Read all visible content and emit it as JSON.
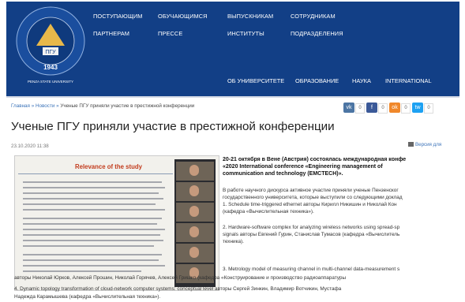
{
  "header": {
    "logo": {
      "year": "1943",
      "ring_text": "ПЕНЗЕНСКИЙ ГОСУДАРСТВЕННЫЙ УНИВЕРСИТЕТ",
      "bottom_text": "PENZA STATE UNIVERSITY",
      "book_letters": "ПГУ"
    },
    "nav_top_row1": [
      "ПОСТУПАЮЩИМ",
      "ОБУЧАЮЩИМСЯ",
      "ВЫПУСКНИКАМ",
      "СОТРУДНИКАМ"
    ],
    "nav_top_row2": [
      "ПАРТНЕРАМ",
      "ПРЕССЕ",
      "ИНСТИТУТЫ",
      "ПОДРАЗДЕЛЕНИЯ"
    ],
    "nav_bottom": [
      "ОБ УНИВЕРСИТЕТЕ",
      "ОБРАЗОВАНИЕ",
      "НАУКА",
      "INTERNATIONAL"
    ]
  },
  "breadcrumb": {
    "home": "Главная",
    "sep": "»",
    "news": "Новости",
    "current": "Ученые ПГУ приняли участие в престижной конференции"
  },
  "share": {
    "buttons": [
      "vk",
      "f",
      "ok",
      "tw"
    ],
    "counts": [
      "0",
      "0",
      "0",
      "0"
    ],
    "colors": [
      "#4c75a3",
      "#3b5998",
      "#f0882b",
      "#1da1f2"
    ]
  },
  "article": {
    "title": "Ученые ПГУ приняли участие в престижной конференции",
    "date": "23.10.2020 11:38",
    "print_label": "Версия для",
    "slide_title": "Relevance of the study",
    "lead_lines": [
      "20-21 октября в Вене (Австрия) состоялась международная конфе",
      "«2020 International conference «Engineering management of",
      "communication and technology (EMCTECH)»."
    ],
    "para1": [
      "В работе научного дискурса активное участие приняли ученые Пензенског",
      "государственного университета, которые выступили со следующими доклад",
      "1. Schedule time-triggered ethernet авторы Кирилл Никишин и Николай Кон",
      "(кафедра «Вычислительная техника»)."
    ],
    "para2": [
      "2. Hardware-software complex for analyzing wireless networks using spread-sp",
      "signals авторы Евгений Гурин, Станислав Тумасов (кафедра «Вычислитель",
      "техника)."
    ],
    "para3_start": "3. Metrology model of measuring channel in multi-channel data-measurement s",
    "para3_cont": "авторы Николай Юрков, Алексей Прошин, Николай Горячев, Алексей Гришко (кафедра «Конструирование и производство радиоаппаратуры",
    "para4": [
      "4. Dynamic topology transformation of cloud-network computer systems: conceptual level авторы Сергей Зинкин, Владимир Вотчикин, Мустафа",
      "Надежда Карамышева (кафедра «Вычислительная техника»)."
    ]
  },
  "colors": {
    "header_bg": "#123f86",
    "link": "#3b73b9",
    "slide_title": "#c23c1d"
  }
}
